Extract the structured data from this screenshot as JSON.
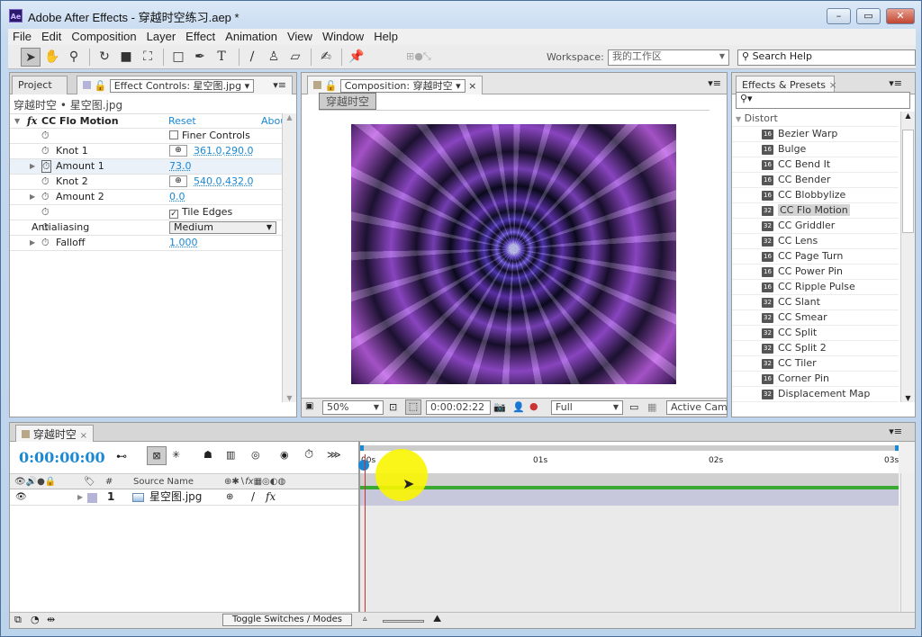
{
  "window": {
    "app_icon": "Ae",
    "title": "Adobe After Effects - 穿越时空练习.aep *",
    "minimize": "–",
    "maximize": "▭",
    "close": "✕"
  },
  "menu": [
    "File",
    "Edit",
    "Composition",
    "Layer",
    "Effect",
    "Animation",
    "View",
    "Window",
    "Help"
  ],
  "toolbar": {
    "workspace_label": "Workspace:",
    "workspace_value": "我的工作区",
    "search_placeholder": "Search Help"
  },
  "effect_controls": {
    "tab_project": "Project",
    "tab_title": "Effect Controls: 星空图.jpg",
    "breadcrumb": "穿越时空 • 星空图.jpg",
    "effect_name": "CC Flo Motion",
    "reset": "Reset",
    "about": "Abou",
    "rows": [
      {
        "label": "Finer Controls",
        "type": "checkbox",
        "checked": false
      },
      {
        "label": "Knot 1",
        "type": "point",
        "value": "361.0,290.0"
      },
      {
        "label": "Amount 1",
        "type": "number",
        "value": "73.0"
      },
      {
        "label": "Knot 2",
        "type": "point",
        "value": "540.0,432.0"
      },
      {
        "label": "Amount 2",
        "type": "number",
        "value": "0.0"
      },
      {
        "label": "Tile Edges",
        "type": "checkbox",
        "checked": true
      },
      {
        "label": "Antialiasing",
        "type": "select",
        "value": "Medium"
      },
      {
        "label": "Falloff",
        "type": "number",
        "value": "1.000"
      }
    ]
  },
  "composition": {
    "tab_title": "Composition: 穿越时空",
    "comp_button": "穿越时空",
    "zoom": "50%",
    "timecode": "0:00:02:22",
    "resolution": "Full",
    "camera": "Active Came"
  },
  "effects_presets": {
    "tab_title": "Effects & Presets",
    "category": "Distort",
    "items": [
      {
        "name": "Bezier Warp",
        "bits": "16"
      },
      {
        "name": "Bulge",
        "bits": "16"
      },
      {
        "name": "CC Bend It",
        "bits": "16"
      },
      {
        "name": "CC Bender",
        "bits": "16"
      },
      {
        "name": "CC Blobbylize",
        "bits": "16"
      },
      {
        "name": "CC Flo Motion",
        "bits": "32",
        "selected": true
      },
      {
        "name": "CC Griddler",
        "bits": "32"
      },
      {
        "name": "CC Lens",
        "bits": "32"
      },
      {
        "name": "CC Page Turn",
        "bits": "16"
      },
      {
        "name": "CC Power Pin",
        "bits": "16"
      },
      {
        "name": "CC Ripple Pulse",
        "bits": "16"
      },
      {
        "name": "CC Slant",
        "bits": "32"
      },
      {
        "name": "CC Smear",
        "bits": "32"
      },
      {
        "name": "CC Split",
        "bits": "32"
      },
      {
        "name": "CC Split 2",
        "bits": "32"
      },
      {
        "name": "CC Tiler",
        "bits": "32"
      },
      {
        "name": "Corner Pin",
        "bits": "16"
      },
      {
        "name": "Displacement Map",
        "bits": "32"
      }
    ]
  },
  "timeline": {
    "tab_title": "穿越时空",
    "current_time": "0:00:00:00",
    "col_number": "#",
    "col_source": "Source Name",
    "ruler": [
      "00s",
      "01s",
      "02s",
      "03s"
    ],
    "layers": [
      {
        "index": "1",
        "name": "星空图.jpg",
        "color": "#b4b4d8"
      }
    ],
    "toggle_button": "Toggle Switches / Modes"
  },
  "colors": {
    "accent_blue": "#1a88d4",
    "work_area_green": "#3aaa35",
    "layer_bar": "#c8c8dc",
    "playhead": "#d03030"
  }
}
